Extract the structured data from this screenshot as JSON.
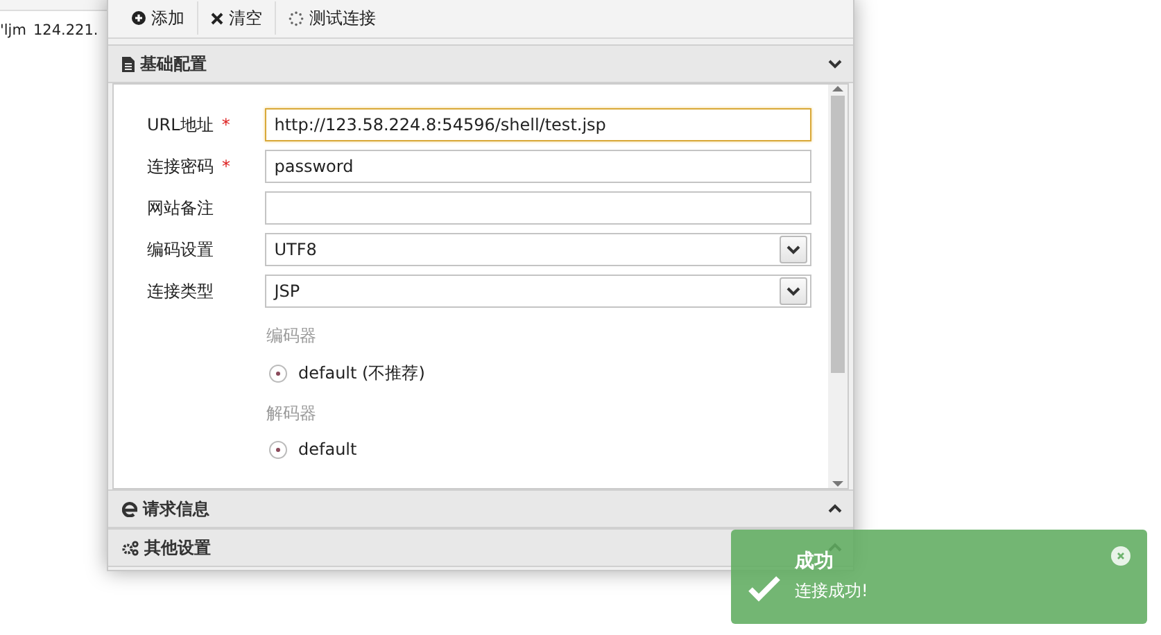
{
  "background_list": {
    "row_cells": [
      "'ljm",
      "124.221."
    ]
  },
  "toolbar": {
    "buttons": [
      {
        "kind": "add",
        "label": "添加"
      },
      {
        "kind": "clear",
        "label": "清空"
      },
      {
        "kind": "test",
        "label": "测试连接"
      }
    ]
  },
  "sections": [
    {
      "kind": "basic",
      "title": "基础配置",
      "expanded": true
    },
    {
      "kind": "request",
      "title": "请求信息",
      "expanded": false
    },
    {
      "kind": "other",
      "title": "其他设置",
      "expanded": false
    }
  ],
  "form": {
    "fields": [
      {
        "kind": "text",
        "label": "URL地址",
        "required_mark": "*",
        "value": "http://123.58.224.8:54596/shell/test.jsp",
        "focused": true
      },
      {
        "kind": "text",
        "label": "连接密码",
        "required_mark": "*",
        "value": "password",
        "focused": false
      },
      {
        "kind": "text",
        "label": "网站备注",
        "focused": false
      },
      {
        "kind": "select",
        "label": "编码设置",
        "value": "UTF8",
        "focused": false
      },
      {
        "kind": "select",
        "label": "连接类型",
        "value": "JSP",
        "focused": false
      }
    ],
    "groups": [
      {
        "title": "编码器",
        "options": [
          {
            "label": "default (不推荐)",
            "selected": true
          }
        ]
      },
      {
        "title": "解码器",
        "options": [
          {
            "label": "default",
            "selected": true
          }
        ]
      }
    ]
  },
  "toast": {
    "title": "成功",
    "message": "连接成功!"
  }
}
